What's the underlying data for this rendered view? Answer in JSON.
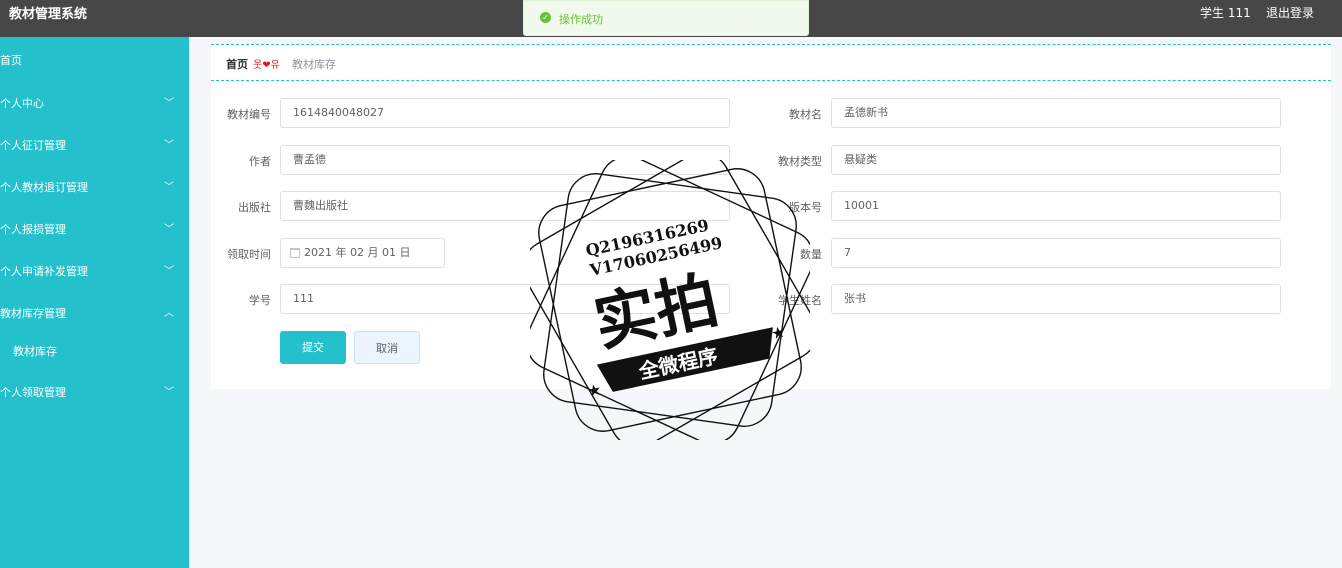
{
  "app": {
    "title": "教材管理系统"
  },
  "header": {
    "user": "学生 111",
    "logout": "退出登录"
  },
  "toast": {
    "message": "操作成功",
    "icon": "check-circle-icon",
    "color": "#67c23a"
  },
  "sidebar": {
    "items": [
      {
        "label": "首页"
      },
      {
        "label": "个人中心"
      },
      {
        "label": "个人征订管理"
      },
      {
        "label": "个人教材退订管理"
      },
      {
        "label": "个人报损管理"
      },
      {
        "label": "个人申请补发管理"
      },
      {
        "label": "教材库存管理"
      },
      {
        "label": "教材库存"
      },
      {
        "label": "个人领取管理"
      }
    ]
  },
  "breadcrumb": {
    "home": "首页",
    "separator": "❤",
    "current": "教材库存"
  },
  "form": {
    "textbook_no": {
      "label": "教材编号",
      "value": "1614840048027"
    },
    "textbook_name": {
      "label": "教材名",
      "value": "孟德新书"
    },
    "author": {
      "label": "作者",
      "value": "曹孟德"
    },
    "category": {
      "label": "教材类型",
      "value": "悬疑类"
    },
    "publisher": {
      "label": "出版社",
      "value": "曹魏出版社"
    },
    "edition": {
      "label": "版本号",
      "value": "10001"
    },
    "receive_time": {
      "label": "领取时间",
      "value": "2021 年 02 月 01 日"
    },
    "quantity": {
      "label": "数量",
      "value": "7"
    },
    "student_no": {
      "label": "学号",
      "value": "111"
    },
    "student_name": {
      "label": "学生姓名",
      "value": "张书"
    },
    "submit": "提交",
    "cancel": "取消"
  },
  "watermark": {
    "line1": "Q2196316269",
    "line2": "V17060256499",
    "big": "实拍",
    "banner": "全微程序"
  },
  "colors": {
    "accent": "#24c0cc",
    "topbar": "#474747",
    "heart": "#e0161b"
  }
}
